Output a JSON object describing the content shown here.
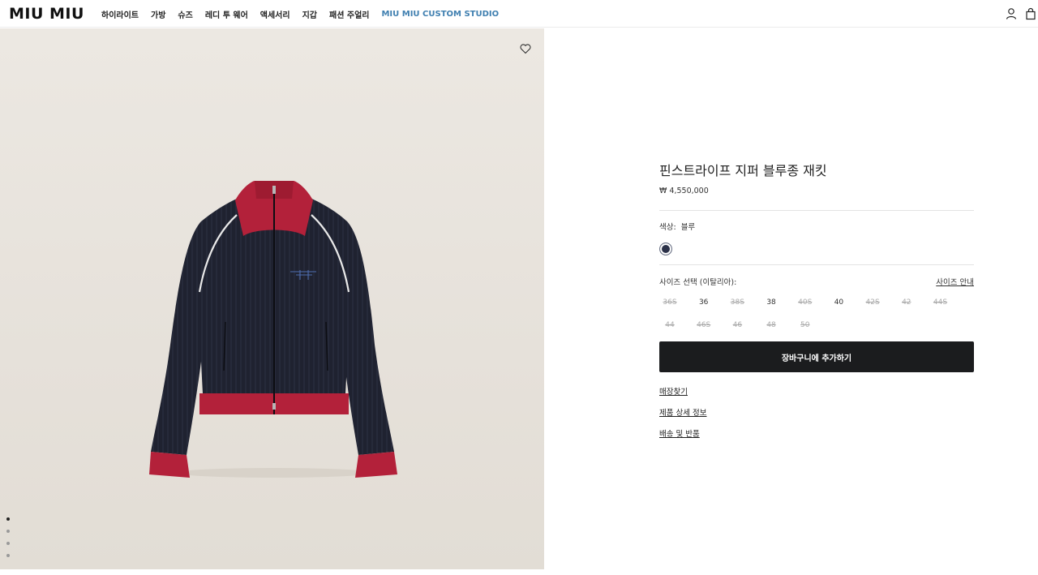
{
  "header": {
    "logo": "MIU MIU",
    "nav": [
      {
        "label": "하이라이트"
      },
      {
        "label": "가방"
      },
      {
        "label": "슈즈"
      },
      {
        "label": "레디 투 웨어"
      },
      {
        "label": "액세서리"
      },
      {
        "label": "지갑"
      },
      {
        "label": "패션 주얼리"
      },
      {
        "label": "MIU MIU CUSTOM STUDIO"
      }
    ],
    "icons": [
      "account-icon",
      "bag-icon"
    ]
  },
  "gallery": {
    "wishlist_icon": "heart-icon",
    "slides_count": 4,
    "active_slide": 1
  },
  "product": {
    "title": "핀스트라이프 지퍼 블루종 재킷",
    "price": "₩ 4,550,000",
    "color_label": "색상:",
    "color_value": "블루",
    "swatch_color": "#2b3148",
    "size_label": "사이즈 선택 (이탈리아):",
    "size_guide": "사이즈 안내",
    "sizes": [
      {
        "label": "36S",
        "available": false
      },
      {
        "label": "36",
        "available": true
      },
      {
        "label": "38S",
        "available": false
      },
      {
        "label": "38",
        "available": true
      },
      {
        "label": "40S",
        "available": false
      },
      {
        "label": "40",
        "available": true
      },
      {
        "label": "42S",
        "available": false
      },
      {
        "label": "42",
        "available": false
      },
      {
        "label": "44S",
        "available": false
      },
      {
        "label": "44",
        "available": false
      },
      {
        "label": "46S",
        "available": false
      },
      {
        "label": "46",
        "available": false
      },
      {
        "label": "48",
        "available": false
      },
      {
        "label": "50",
        "available": false
      }
    ],
    "add_to_cart": "장바구니에 추가하기",
    "links": [
      "매장찾기",
      "제품 상세 정보",
      "배송 및 반품"
    ]
  }
}
